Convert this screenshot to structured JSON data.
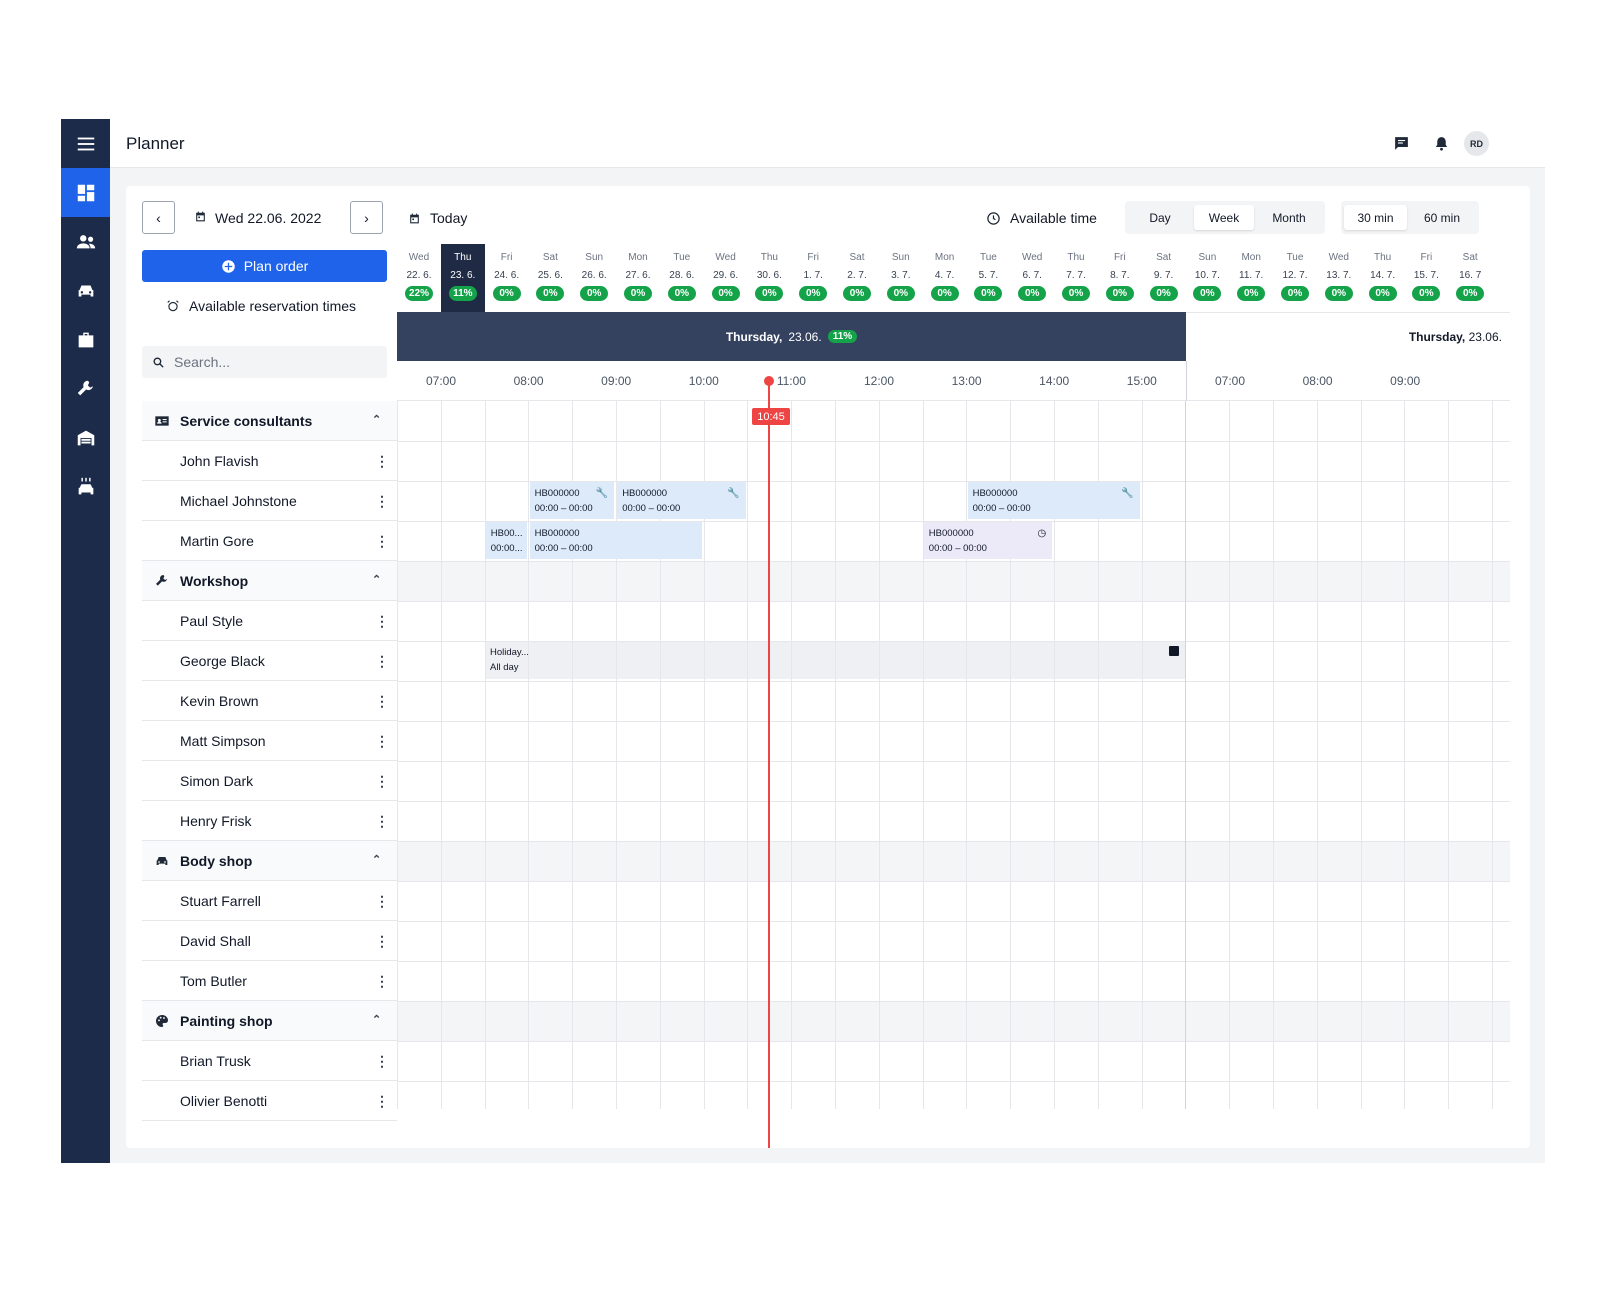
{
  "header": {
    "title": "Planner",
    "avatar": "RD"
  },
  "nav": {
    "items": [
      "dashboard-icon",
      "people-icon",
      "car-icon",
      "briefcase-icon",
      "wrench-icon",
      "garage-icon",
      "car-wash-icon"
    ]
  },
  "toolbar": {
    "date": "Wed 22.06. 2022",
    "prev": "‹",
    "next": "›",
    "today": "Today",
    "available_time": "Available time",
    "views": [
      "Day",
      "Week",
      "Month"
    ],
    "selected_view": "Week",
    "intervals": [
      "30 min",
      "60 min"
    ],
    "selected_interval": "30 min"
  },
  "sidebar": {
    "plan_order": "Plan order",
    "available_reservation_times": "Available reservation times",
    "search_placeholder": "Search...",
    "groups": [
      {
        "name": "Service consultants",
        "icon": "id-card-icon",
        "members": [
          "John Flavish",
          "Michael Johnstone",
          "Martin Gore"
        ]
      },
      {
        "name": "Workshop",
        "icon": "wrench-icon",
        "members": [
          "Paul Style",
          "George Black",
          "Kevin Brown",
          "Matt Simpson",
          "Simon Dark",
          "Henry Frisk"
        ]
      },
      {
        "name": "Body shop",
        "icon": "car-icon",
        "members": [
          "Stuart Farrell",
          "David Shall",
          "Tom Butler"
        ]
      },
      {
        "name": "Painting shop",
        "icon": "palette-icon",
        "members": [
          "Brian Trusk",
          "Olivier Benotti"
        ]
      }
    ]
  },
  "days": [
    {
      "name": "Wed",
      "date": "22. 6.",
      "pct": "22%"
    },
    {
      "name": "Thu",
      "date": "23. 6.",
      "pct": "11%",
      "selected": true
    },
    {
      "name": "Fri",
      "date": "24. 6.",
      "pct": "0%"
    },
    {
      "name": "Sat",
      "date": "25. 6.",
      "pct": "0%"
    },
    {
      "name": "Sun",
      "date": "26. 6.",
      "pct": "0%"
    },
    {
      "name": "Mon",
      "date": "27. 6.",
      "pct": "0%"
    },
    {
      "name": "Tue",
      "date": "28. 6.",
      "pct": "0%"
    },
    {
      "name": "Wed",
      "date": "29. 6.",
      "pct": "0%"
    },
    {
      "name": "Thu",
      "date": "30. 6.",
      "pct": "0%"
    },
    {
      "name": "Fri",
      "date": "1. 7.",
      "pct": "0%"
    },
    {
      "name": "Sat",
      "date": "2. 7.",
      "pct": "0%"
    },
    {
      "name": "Sun",
      "date": "3. 7.",
      "pct": "0%"
    },
    {
      "name": "Mon",
      "date": "4. 7.",
      "pct": "0%"
    },
    {
      "name": "Tue",
      "date": "5. 7.",
      "pct": "0%"
    },
    {
      "name": "Wed",
      "date": "6. 7.",
      "pct": "0%"
    },
    {
      "name": "Thu",
      "date": "7. 7.",
      "pct": "0%"
    },
    {
      "name": "Fri",
      "date": "8. 7.",
      "pct": "0%"
    },
    {
      "name": "Sat",
      "date": "9. 7.",
      "pct": "0%"
    },
    {
      "name": "Sun",
      "date": "10. 7.",
      "pct": "0%"
    },
    {
      "name": "Mon",
      "date": "11. 7.",
      "pct": "0%"
    },
    {
      "name": "Tue",
      "date": "12. 7.",
      "pct": "0%"
    },
    {
      "name": "Wed",
      "date": "13. 7.",
      "pct": "0%"
    },
    {
      "name": "Thu",
      "date": "14. 7.",
      "pct": "0%"
    },
    {
      "name": "Fri",
      "date": "15. 7.",
      "pct": "0%"
    },
    {
      "name": "Sat",
      "date": "16. 7",
      "pct": "0%"
    }
  ],
  "day_band": {
    "weekday": "Thursday,",
    "date": "23.06.",
    "pct": "11%"
  },
  "day_band_next": {
    "weekday": "Thursday,",
    "date": "23.06."
  },
  "hours": [
    "07:00",
    "08:00",
    "09:00",
    "10:00",
    "11:00",
    "12:00",
    "13:00",
    "14:00",
    "15:00",
    "07:00",
    "08:00",
    "09:00"
  ],
  "now": "10:45",
  "events": [
    {
      "code": "HB000000",
      "time": "00:00 – 00:00",
      "icon": "wrench-icon",
      "row": 2,
      "start": "08:00",
      "end": "09:00"
    },
    {
      "code": "HB000000",
      "time": "00:00 – 00:00",
      "icon": "wrench-icon",
      "row": 2,
      "start": "09:00",
      "end": "10:30"
    },
    {
      "code": "HB000000",
      "time": "00:00 – 00:00",
      "icon": "wrench-icon",
      "row": 2,
      "start": "13:00",
      "end": "15:00"
    },
    {
      "code": "HB00...",
      "time": "00:00...",
      "row": 3,
      "start": "07:30",
      "end": "08:00"
    },
    {
      "code": "HB000000",
      "time": "00:00 – 00:00",
      "row": 3,
      "start": "08:00",
      "end": "10:00"
    },
    {
      "code": "HB000000",
      "time": "00:00 – 00:00",
      "icon": "clock-icon",
      "row": 3,
      "start": "12:30",
      "end": "14:00",
      "tone": "lavender"
    }
  ],
  "holiday": {
    "title": "Holiday...",
    "subtitle": "All day",
    "icon": "camera-off-icon"
  }
}
